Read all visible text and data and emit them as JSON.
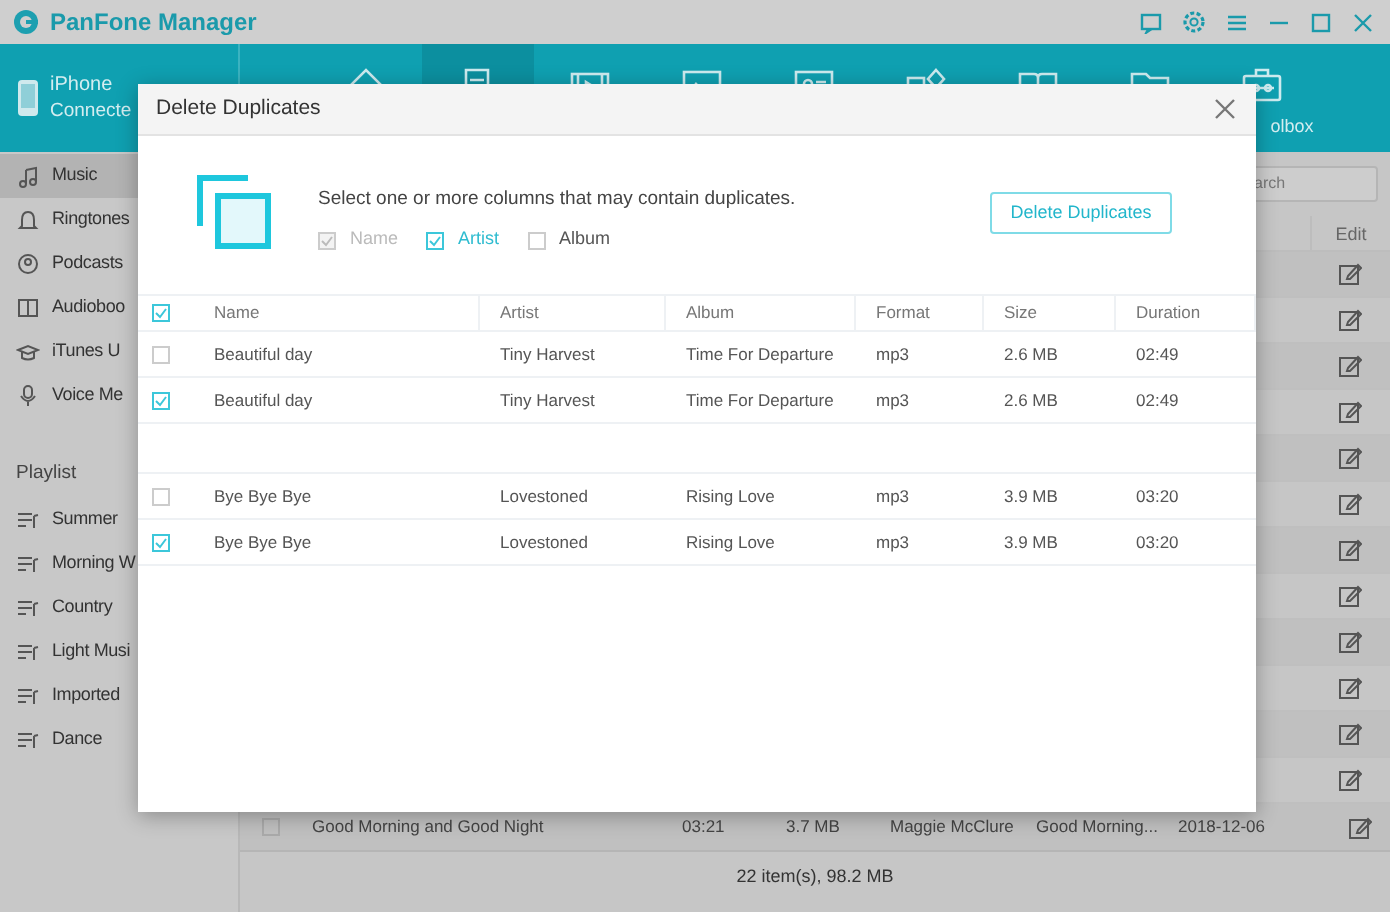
{
  "window": {
    "title": "PanFone Manager"
  },
  "toolbar": {
    "items": [
      {
        "selected": false
      },
      {
        "selected": true
      },
      {
        "selected": false
      },
      {
        "selected": false
      },
      {
        "selected": false
      },
      {
        "selected": false
      },
      {
        "selected": false
      },
      {
        "selected": false
      },
      {
        "selected": false,
        "label": "olbox"
      }
    ]
  },
  "device": {
    "name": "iPhone",
    "status": "Connecte"
  },
  "sidebar": {
    "items": [
      {
        "label": "Music",
        "selected": true
      },
      {
        "label": "Ringtones",
        "selected": false
      },
      {
        "label": "Podcasts",
        "selected": false
      },
      {
        "label": "Audioboo",
        "selected": false
      },
      {
        "label": "iTunes U",
        "selected": false
      },
      {
        "label": "Voice Me",
        "selected": false
      }
    ],
    "playlist_heading": "Playlist",
    "playlists": [
      {
        "label": "Summer"
      },
      {
        "label": "Morning W"
      },
      {
        "label": "Country"
      },
      {
        "label": "Light Musi"
      },
      {
        "label": "Imported"
      },
      {
        "label": "Dance"
      }
    ]
  },
  "main": {
    "search": {
      "placeholder": "arch"
    },
    "edit_header": "Edit",
    "last_row": {
      "checked": false,
      "cells": [
        "Good Morning and Good Night",
        "03:21",
        "3.7 MB",
        "Maggie McClure",
        "Good Morning...",
        "2018-12-06"
      ]
    }
  },
  "status_bar": "22 item(s), 98.2 MB",
  "dialog": {
    "title": "Delete Duplicates",
    "prompt": "Select one or more columns that may contain duplicates.",
    "column_options": [
      {
        "label": "Name",
        "checked": true,
        "disabled": true
      },
      {
        "label": "Artist",
        "checked": true,
        "disabled": false
      },
      {
        "label": "Album",
        "checked": false,
        "disabled": false
      }
    ],
    "button": "Delete Duplicates",
    "table": {
      "select_all": true,
      "columns": [
        "Name",
        "Artist",
        "Album",
        "Format",
        "Size",
        "Duration"
      ],
      "groups": [
        {
          "rows": [
            {
              "checked": false,
              "cells": [
                "Beautiful day",
                "Tiny Harvest",
                "Time For Departure",
                "mp3",
                "2.6 MB",
                "02:49"
              ]
            },
            {
              "checked": true,
              "cells": [
                "Beautiful day",
                "Tiny Harvest",
                "Time For Departure",
                "mp3",
                "2.6 MB",
                "02:49"
              ]
            }
          ]
        },
        {
          "rows": [
            {
              "checked": false,
              "cells": [
                "Bye Bye Bye",
                "Lovestoned",
                "Rising Love",
                "mp3",
                "3.9 MB",
                "03:20"
              ]
            },
            {
              "checked": true,
              "cells": [
                "Bye Bye Bye",
                "Lovestoned",
                "Rising Love",
                "mp3",
                "3.9 MB",
                "03:20"
              ]
            }
          ]
        }
      ]
    }
  }
}
